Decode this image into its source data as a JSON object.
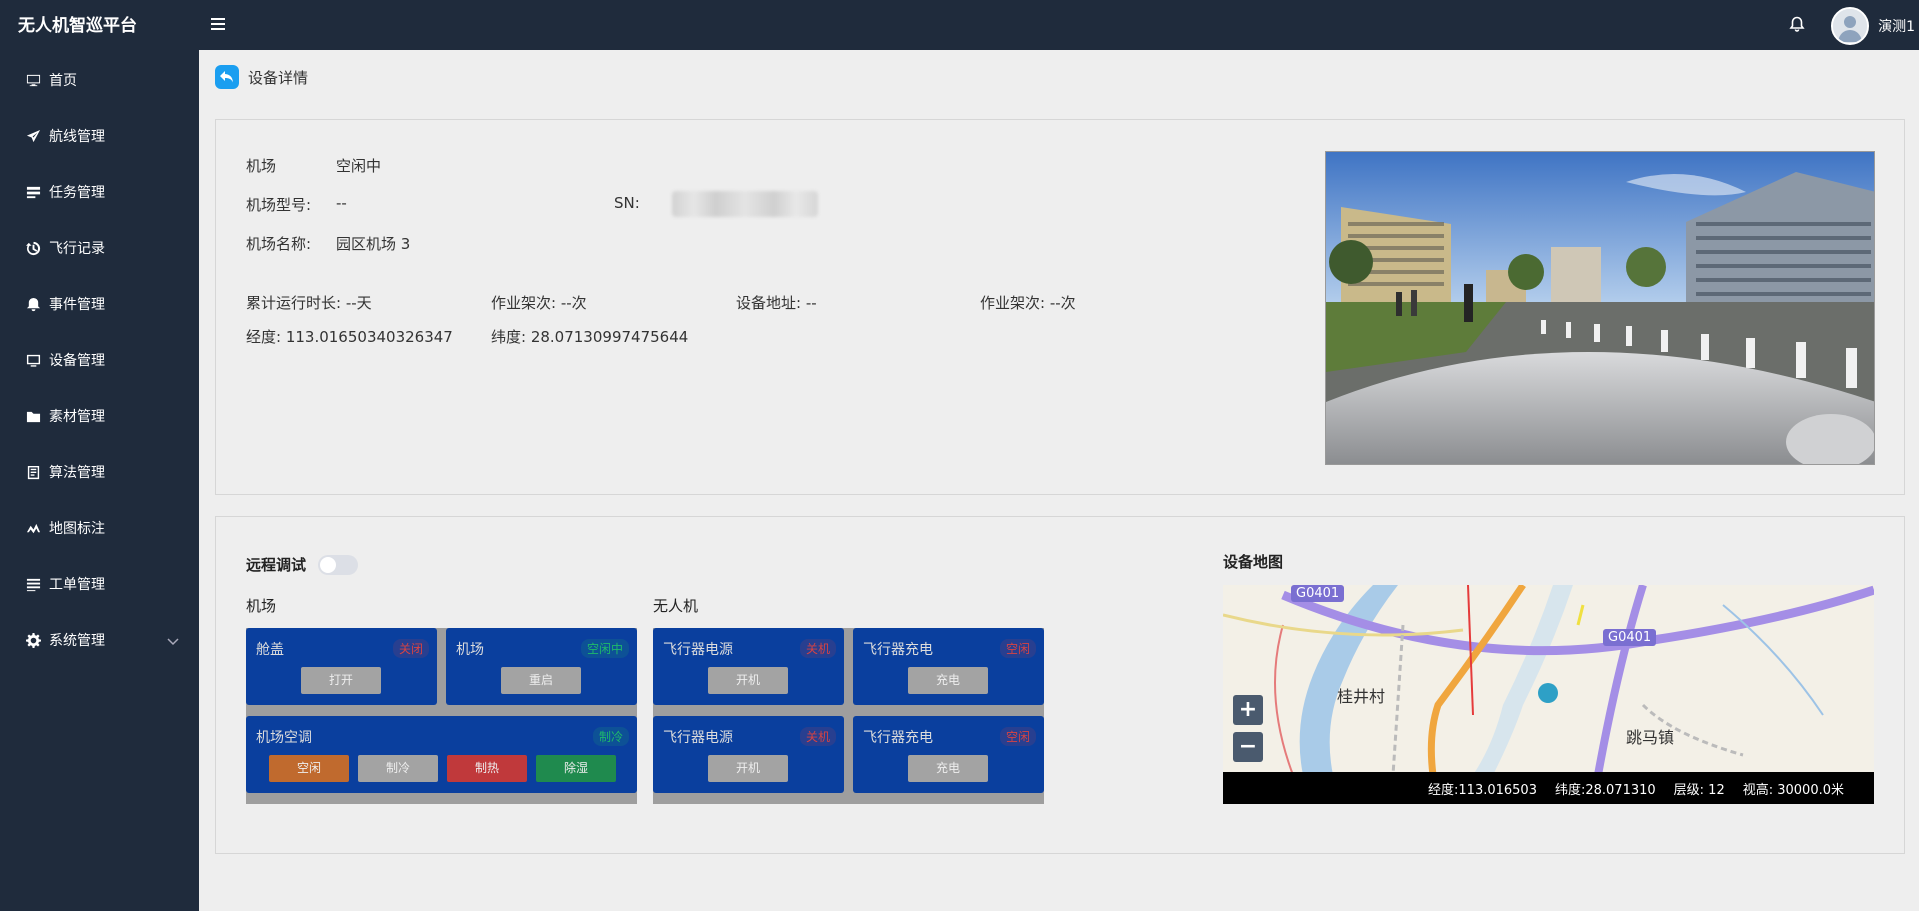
{
  "app": {
    "title": "无人机智巡平台"
  },
  "sidebar": {
    "items": [
      {
        "label": "首页",
        "icon": "monitor-icon"
      },
      {
        "label": "航线管理",
        "icon": "plane-icon"
      },
      {
        "label": "任务管理",
        "icon": "tasks-icon"
      },
      {
        "label": "飞行记录",
        "icon": "history-icon"
      },
      {
        "label": "事件管理",
        "icon": "bell-icon"
      },
      {
        "label": "设备管理",
        "icon": "device-icon"
      },
      {
        "label": "素材管理",
        "icon": "folder-icon"
      },
      {
        "label": "算法管理",
        "icon": "algorithm-icon"
      },
      {
        "label": "地图标注",
        "icon": "map-pin-icon"
      },
      {
        "label": "工单管理",
        "icon": "list-icon"
      },
      {
        "label": "系统管理",
        "icon": "gear-icon"
      }
    ]
  },
  "header": {
    "username": "演测1"
  },
  "page": {
    "title": "设备详情"
  },
  "info": {
    "airport_label": "机场",
    "airport_status": "空闲中",
    "model_label": "机场型号:",
    "model_value": "--",
    "sn_label": "SN:",
    "name_label": "机场名称:",
    "name_value": "园区机场 3",
    "runtime": "累计运行时长: --天",
    "sorties1": "作业架次: --次",
    "address": "设备地址: --",
    "sorties2": "作业架次: --次",
    "longitude": "经度: 113.01650340326347",
    "latitude": "纬度: 28.07130997475644"
  },
  "control": {
    "remote_label": "远程调试",
    "remote_enabled": false,
    "airport_group": "机场",
    "drone_group": "无人机",
    "tiles": {
      "hatch": {
        "name": "舱盖",
        "status": "关闭",
        "button": "打开"
      },
      "airport": {
        "name": "机场",
        "status": "空闲中",
        "button": "重启"
      },
      "ac": {
        "name": "机场空调",
        "status": "制冷",
        "buttons": [
          "空闲",
          "制冷",
          "制热",
          "除湿"
        ]
      },
      "power1": {
        "name": "飞行器电源",
        "status": "关机",
        "button": "开机"
      },
      "charge1": {
        "name": "飞行器充电",
        "status": "空闲",
        "button": "充电"
      },
      "power2": {
        "name": "飞行器电源",
        "status": "关机",
        "button": "开机"
      },
      "charge2": {
        "name": "飞行器充电",
        "status": "空闲",
        "button": "充电"
      }
    },
    "colors": {
      "tile": "#0a3f9e",
      "btn_idle": "#c06a2e",
      "btn_default": "#a3a3a3",
      "btn_heat": "#c0393b",
      "btn_dehumid": "#1f8a4e"
    }
  },
  "map": {
    "title": "设备地图",
    "labels": {
      "village": "桂井村",
      "town": "跳马镇",
      "road1": "G0401",
      "road2": "G0401",
      "zoom_in": "+",
      "zoom_out": "−"
    },
    "status": {
      "lng": "经度:113.016503",
      "lat": "纬度:28.071310",
      "level": "层级: 12",
      "height": "视高: 30000.0米"
    }
  }
}
